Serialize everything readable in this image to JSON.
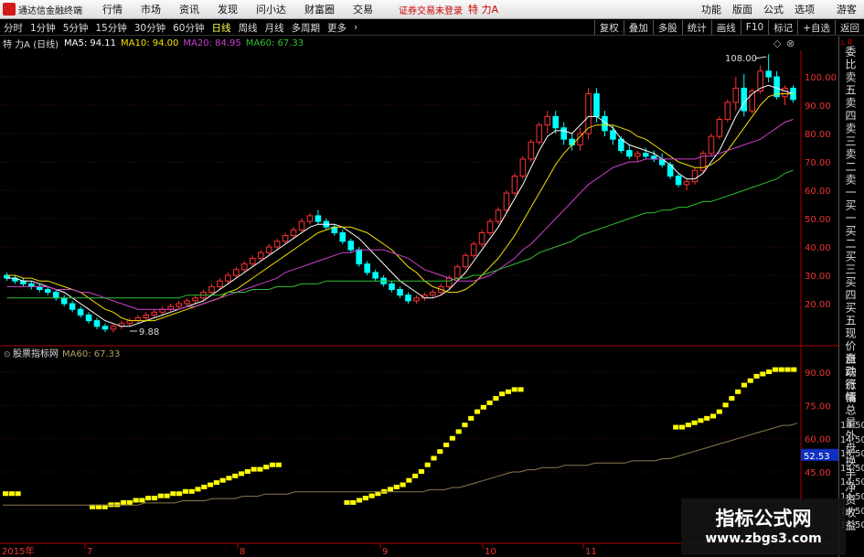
{
  "menubar": {
    "app_title": "通达信金融终端",
    "items": [
      "行情",
      "市场",
      "资讯",
      "发现",
      "问小达",
      "财富圈",
      "交易"
    ],
    "status": "证券交易未登录",
    "stock": "特 力A",
    "right_items": [
      "功能",
      "版面",
      "公式",
      "选项"
    ],
    "guest": "游客"
  },
  "periodbar": {
    "periods": [
      "分时",
      "1分钟",
      "5分钟",
      "15分钟",
      "30分钟",
      "60分钟",
      "日线",
      "周线",
      "月线",
      "多周期",
      "更多"
    ],
    "active": "日线",
    "tools": [
      "复权",
      "叠加",
      "多股",
      "统计",
      "画线",
      "F10",
      "标记",
      "+自选",
      "返回"
    ]
  },
  "info": {
    "title": "特 力A (日线)",
    "ma": [
      {
        "label": "MA5: 94.11",
        "color": "#ffffff"
      },
      {
        "label": "MA10: 94.00",
        "color": "#f5e000"
      },
      {
        "label": "MA20: 84.95",
        "color": "#d040d0"
      },
      {
        "label": "MA60: 67.33",
        "color": "#30c030"
      }
    ]
  },
  "indicator_info": {
    "title": "股票指标网",
    "ma": "MA60: 67.33",
    "color": "#b0a060"
  },
  "price_axis": [
    "100.00",
    "90.00",
    "80.00",
    "70.00",
    "60.00",
    "50.00",
    "40.00",
    "30.00",
    "20.00"
  ],
  "indicator_axis": [
    "90.00",
    "75.00",
    "60.00",
    "45.00"
  ],
  "indicator_highlight": "52.53",
  "annotations": {
    "high": "108.00",
    "low": "9.88"
  },
  "date_axis": [
    "2015年",
    "7",
    "8",
    "9",
    "10",
    "11"
  ],
  "right_panel": {
    "top": "L R",
    "main_labels": "委比卖五卖四卖三卖二卖一买一买二买三买四买五现价涨跌涨幅总量外盘换手净资收益",
    "lower_labels": "自动行情",
    "times": [
      "14:50",
      "14:50",
      "14:50",
      "14:50",
      "14:50",
      "14:50",
      "14:50",
      "14:50"
    ]
  },
  "watermark": {
    "title": "指标公式网",
    "url": "www.zbgs3.com"
  },
  "colors": {
    "up": "#ff3232",
    "down": "#00ffff",
    "ma5": "#ffffff",
    "ma10": "#f5e000",
    "ma20": "#d040d0",
    "ma60": "#30c030",
    "indicator": "#ffff00"
  },
  "chart_data": {
    "type": "candlestick",
    "ylim": [
      0,
      112
    ],
    "candles": [
      [
        30,
        31,
        28,
        29
      ],
      [
        29,
        30,
        27,
        28
      ],
      [
        28,
        29,
        26,
        27
      ],
      [
        27,
        28,
        25,
        26
      ],
      [
        26,
        27,
        24,
        25
      ],
      [
        25,
        26,
        23,
        24
      ],
      [
        24,
        25,
        21,
        22
      ],
      [
        22,
        23,
        19,
        20
      ],
      [
        20,
        21,
        17,
        18
      ],
      [
        18,
        19,
        15,
        16
      ],
      [
        16,
        17,
        13,
        14
      ],
      [
        14,
        15,
        11,
        12
      ],
      [
        12,
        13,
        10,
        11
      ],
      [
        11,
        13,
        9.88,
        12
      ],
      [
        12,
        14,
        11,
        13
      ],
      [
        13,
        15,
        12,
        14
      ],
      [
        14,
        16,
        13,
        15
      ],
      [
        15,
        17,
        14,
        16
      ],
      [
        16,
        18,
        15,
        17
      ],
      [
        17,
        19,
        16,
        18
      ],
      [
        18,
        20,
        17,
        19
      ],
      [
        19,
        21,
        18,
        20
      ],
      [
        20,
        22,
        19,
        21
      ],
      [
        21,
        23,
        20,
        22
      ],
      [
        22,
        25,
        21,
        24
      ],
      [
        24,
        27,
        23,
        26
      ],
      [
        26,
        29,
        25,
        28
      ],
      [
        28,
        31,
        27,
        30
      ],
      [
        30,
        33,
        29,
        32
      ],
      [
        32,
        35,
        31,
        34
      ],
      [
        34,
        37,
        33,
        36
      ],
      [
        36,
        39,
        35,
        38
      ],
      [
        38,
        41,
        37,
        40
      ],
      [
        40,
        43,
        39,
        42
      ],
      [
        42,
        45,
        41,
        44
      ],
      [
        44,
        47,
        43,
        46
      ],
      [
        46,
        50,
        45,
        49
      ],
      [
        49,
        52,
        48,
        51
      ],
      [
        51,
        53,
        48,
        49
      ],
      [
        49,
        50,
        46,
        47
      ],
      [
        47,
        48,
        44,
        45
      ],
      [
        45,
        46,
        41,
        42
      ],
      [
        42,
        43,
        38,
        39
      ],
      [
        39,
        40,
        33,
        34
      ],
      [
        34,
        35,
        30,
        31
      ],
      [
        31,
        32,
        28,
        29
      ],
      [
        29,
        30,
        26,
        27
      ],
      [
        27,
        28,
        24,
        25
      ],
      [
        25,
        26,
        22,
        23
      ],
      [
        23,
        24,
        20,
        21
      ],
      [
        21,
        23,
        20,
        22
      ],
      [
        22,
        24,
        21,
        23
      ],
      [
        23,
        25,
        22,
        24
      ],
      [
        24,
        27,
        23,
        26
      ],
      [
        26,
        30,
        25,
        29
      ],
      [
        29,
        34,
        28,
        33
      ],
      [
        33,
        38,
        32,
        37
      ],
      [
        37,
        42,
        36,
        41
      ],
      [
        41,
        46,
        40,
        45
      ],
      [
        45,
        50,
        44,
        49
      ],
      [
        49,
        54,
        48,
        53
      ],
      [
        53,
        60,
        52,
        59
      ],
      [
        59,
        66,
        58,
        65
      ],
      [
        65,
        72,
        64,
        71
      ],
      [
        71,
        78,
        70,
        77
      ],
      [
        77,
        84,
        76,
        83
      ],
      [
        83,
        88,
        80,
        86
      ],
      [
        86,
        88,
        80,
        82
      ],
      [
        82,
        84,
        76,
        78
      ],
      [
        78,
        80,
        74,
        76
      ],
      [
        76,
        82,
        74,
        80
      ],
      [
        80,
        96,
        78,
        94
      ],
      [
        94,
        96,
        84,
        86
      ],
      [
        86,
        88,
        79,
        81
      ],
      [
        81,
        83,
        76,
        78
      ],
      [
        78,
        79,
        73,
        74
      ],
      [
        74,
        76,
        71,
        72
      ],
      [
        72,
        74,
        70,
        73
      ],
      [
        73,
        75,
        71,
        72
      ],
      [
        72,
        74,
        70,
        71
      ],
      [
        71,
        73,
        68,
        69
      ],
      [
        69,
        70,
        64,
        65
      ],
      [
        65,
        66,
        61,
        62
      ],
      [
        62,
        64,
        60,
        63
      ],
      [
        63,
        68,
        62,
        67
      ],
      [
        67,
        74,
        66,
        73
      ],
      [
        73,
        80,
        72,
        79
      ],
      [
        79,
        86,
        78,
        85
      ],
      [
        85,
        92,
        84,
        91
      ],
      [
        91,
        100,
        88,
        96
      ],
      [
        96,
        101,
        86,
        88
      ],
      [
        88,
        96,
        87,
        95
      ],
      [
        95,
        104,
        94,
        102
      ],
      [
        102,
        108,
        98,
        100
      ],
      [
        100,
        102,
        92,
        93
      ],
      [
        93,
        97,
        90,
        96
      ],
      [
        96,
        97,
        91,
        92
      ]
    ],
    "ma5": [
      29,
      29,
      28,
      28,
      27,
      26,
      25,
      24,
      22,
      20,
      18,
      16,
      14,
      13,
      12,
      12,
      13,
      14,
      15,
      16,
      17,
      18,
      19,
      20,
      21,
      23,
      25,
      27,
      29,
      31,
      33,
      35,
      37,
      39,
      41,
      43,
      45,
      47,
      48,
      48,
      48,
      47,
      45,
      43,
      40,
      37,
      34,
      31,
      28,
      26,
      24,
      22,
      22,
      23,
      25,
      28,
      31,
      35,
      39,
      43,
      47,
      52,
      57,
      62,
      68,
      74,
      79,
      81,
      81,
      80,
      83,
      86,
      86,
      84,
      82,
      78,
      76,
      75,
      74,
      73,
      71,
      69,
      66,
      64,
      64,
      66,
      70,
      74,
      80,
      86,
      91,
      94,
      96,
      97,
      96,
      95,
      94
    ],
    "ma10": [
      30,
      30,
      29,
      29,
      28,
      28,
      27,
      26,
      25,
      24,
      22,
      20,
      18,
      17,
      15,
      14,
      14,
      14,
      14,
      15,
      16,
      17,
      18,
      19,
      20,
      21,
      22,
      24,
      25,
      27,
      29,
      31,
      33,
      35,
      37,
      39,
      41,
      43,
      45,
      46,
      47,
      47,
      47,
      46,
      45,
      43,
      41,
      39,
      36,
      33,
      31,
      28,
      26,
      25,
      24,
      24,
      25,
      27,
      30,
      33,
      36,
      40,
      44,
      49,
      54,
      59,
      64,
      69,
      73,
      76,
      79,
      82,
      83,
      83,
      83,
      82,
      81,
      79,
      78,
      76,
      74,
      72,
      70,
      69,
      68,
      68,
      69,
      71,
      74,
      78,
      82,
      86,
      90,
      93,
      94,
      94,
      94
    ],
    "ma20": [
      26,
      26,
      26,
      26,
      26,
      26,
      25,
      25,
      25,
      24,
      24,
      23,
      22,
      21,
      20,
      19,
      18,
      18,
      18,
      18,
      18,
      18,
      19,
      19,
      20,
      21,
      22,
      23,
      24,
      25,
      26,
      27,
      28,
      29,
      31,
      32,
      33,
      34,
      35,
      36,
      37,
      38,
      38,
      39,
      39,
      39,
      39,
      38,
      37,
      36,
      34,
      32,
      31,
      30,
      29,
      28,
      28,
      28,
      29,
      30,
      32,
      34,
      36,
      39,
      41,
      44,
      47,
      50,
      53,
      56,
      59,
      62,
      64,
      66,
      68,
      69,
      70,
      70,
      71,
      71,
      71,
      71,
      71,
      71,
      71,
      72,
      72,
      73,
      74,
      75,
      76,
      77,
      78,
      80,
      82,
      84,
      85
    ],
    "ma60": [
      22,
      22,
      22,
      22,
      22,
      22,
      22,
      22,
      22,
      22,
      22,
      22,
      22,
      22,
      22,
      22,
      22,
      22,
      22,
      22,
      22,
      22,
      23,
      23,
      23,
      23,
      23,
      24,
      24,
      24,
      25,
      25,
      25,
      26,
      26,
      26,
      27,
      27,
      27,
      28,
      28,
      28,
      28,
      28,
      28,
      28,
      28,
      28,
      28,
      28,
      28,
      28,
      28,
      28,
      28,
      29,
      29,
      30,
      30,
      31,
      32,
      33,
      34,
      35,
      36,
      38,
      39,
      40,
      41,
      42,
      44,
      45,
      46,
      47,
      48,
      49,
      50,
      51,
      52,
      52,
      53,
      53,
      54,
      54,
      55,
      56,
      56,
      57,
      58,
      59,
      60,
      61,
      62,
      63,
      64,
      66,
      67
    ],
    "indicator_values": [
      35,
      35,
      35,
      null,
      null,
      null,
      null,
      null,
      null,
      null,
      null,
      null,
      null,
      null,
      29,
      29,
      29,
      30,
      30,
      31,
      31,
      32,
      32,
      33,
      33,
      34,
      34,
      35,
      35,
      36,
      36,
      37,
      38,
      39,
      40,
      41,
      42,
      43,
      44,
      45,
      46,
      46,
      47,
      48,
      48,
      null,
      null,
      null,
      null,
      null,
      null,
      null,
      null,
      null,
      null,
      31,
      31,
      32,
      33,
      34,
      35,
      36,
      37,
      38,
      39,
      41,
      43,
      45,
      48,
      51,
      54,
      57,
      60,
      63,
      66,
      69,
      72,
      74,
      76,
      78,
      80,
      81,
      82,
      82,
      null,
      null,
      null,
      null,
      null,
      null,
      null,
      null,
      null,
      null,
      null,
      null,
      null,
      null,
      null,
      null,
      null,
      null,
      null,
      null,
      null,
      null,
      null,
      null,
      65,
      65,
      66,
      67,
      68,
      69,
      70,
      72,
      75,
      78,
      81,
      84,
      86,
      88,
      89,
      90,
      91,
      91,
      91,
      91
    ],
    "indicator_ma": [
      30,
      30,
      30,
      30,
      30,
      30,
      30,
      30,
      30,
      30,
      30,
      30,
      30,
      30,
      30,
      30,
      30,
      30,
      30,
      31,
      31,
      31,
      31,
      31,
      32,
      32,
      32,
      32,
      33,
      33,
      33,
      33,
      34,
      34,
      34,
      35,
      35,
      35,
      35,
      36,
      36,
      36,
      36,
      36,
      36,
      36,
      36,
      36,
      36,
      36,
      36,
      36,
      36,
      36,
      36,
      36,
      36,
      37,
      37,
      37,
      38,
      38,
      39,
      40,
      41,
      42,
      43,
      44,
      45,
      45,
      46,
      46,
      47,
      47,
      47,
      48,
      48,
      48,
      48,
      49,
      49,
      49,
      49,
      49,
      50,
      50,
      50,
      50,
      51,
      51,
      52,
      53,
      54,
      55,
      56,
      57,
      58,
      59,
      60,
      61,
      62,
      63,
      64,
      65,
      66,
      66,
      67
    ],
    "indicator_ylim": [
      30,
      100
    ]
  }
}
